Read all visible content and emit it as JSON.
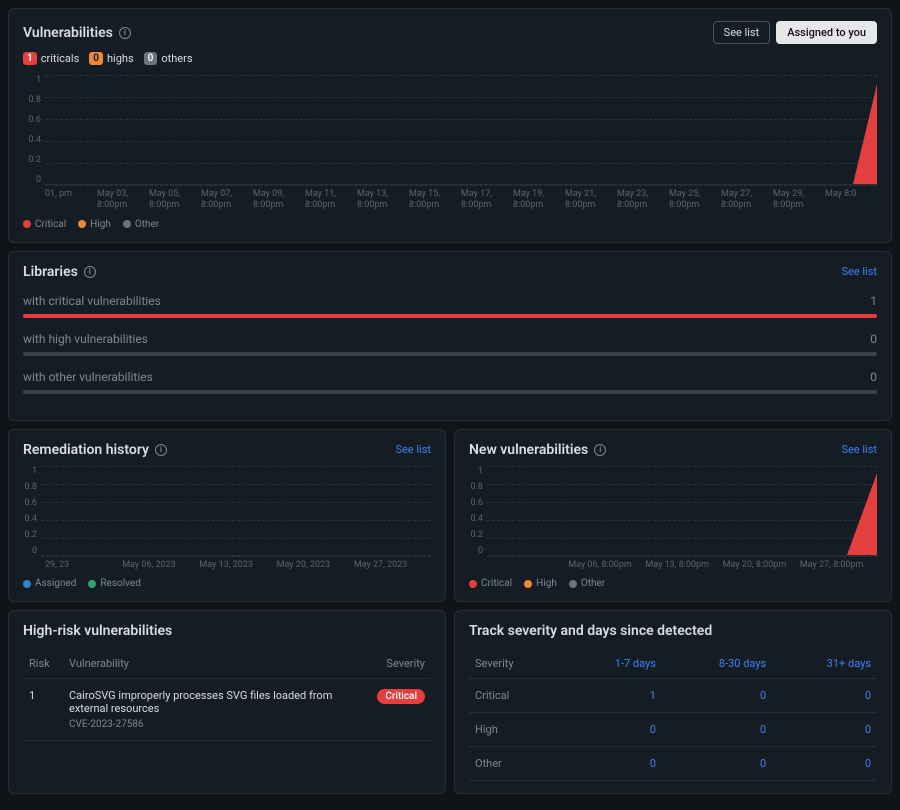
{
  "colors": {
    "red": "#e53e3e",
    "orange": "#ed8936",
    "gray": "#6b7280",
    "green": "#38a169",
    "blue": "#3182ce"
  },
  "vulnerabilities": {
    "title": "Vulnerabilities",
    "see_list": "See list",
    "assigned": "Assigned to you",
    "badges": {
      "criticals_n": "1",
      "criticals": "criticals",
      "highs_n": "0",
      "highs": "highs",
      "others_n": "0",
      "others": "others"
    },
    "legend": {
      "critical": "Critical",
      "high": "High",
      "other": "Other"
    }
  },
  "chart_data": [
    {
      "id": "vuln",
      "type": "area",
      "ylim": [
        0,
        1
      ],
      "yticks": [
        "1",
        "0.8",
        "0.6",
        "0.4",
        "0.2",
        "0"
      ],
      "xticks": [
        "01, pm",
        "May 03, 8:00pm",
        "May 05, 8:00pm",
        "May 07, 8:00pm",
        "May 09, 8:00pm",
        "May 11, 8:00pm",
        "May 13, 8:00pm",
        "May 15, 8:00pm",
        "May 17, 8:00pm",
        "May 19, 8:00pm",
        "May 21, 8:00pm",
        "May 23, 8:00pm",
        "May 25, 8:00pm",
        "May 27, 8:00pm",
        "May 29, 8:00pm",
        "May 8:0"
      ],
      "series": [
        {
          "name": "Critical",
          "color": "#e53e3e",
          "segments": [
            {
              "from": 14.5,
              "to": 15,
              "y0": 0,
              "y1": 1
            }
          ]
        },
        {
          "name": "High",
          "color": "#ed8936",
          "segments": []
        },
        {
          "name": "Other",
          "color": "#6b7280",
          "segments": []
        }
      ]
    },
    {
      "id": "remediation",
      "type": "area",
      "ylim": [
        0,
        1
      ],
      "yticks": [
        "1",
        "0.8",
        "0.6",
        "0.4",
        "0.2",
        "0"
      ],
      "xticks": [
        "29, 23",
        "May 06, 2023",
        "May 13, 2023",
        "May 20, 2023",
        "May 27, 2023"
      ],
      "series": [
        {
          "name": "Assigned",
          "color": "#3182ce",
          "segments": []
        },
        {
          "name": "Resolved",
          "color": "#38a169",
          "segments": []
        }
      ]
    },
    {
      "id": "newvuln",
      "type": "area",
      "ylim": [
        0,
        1
      ],
      "yticks": [
        "1",
        "0.8",
        "0.6",
        "0.4",
        "0.2",
        "0"
      ],
      "xticks": [
        "",
        "May 06, 8:00pm",
        "May 13, 8:00pm",
        "May 20, 8:00pm",
        "May 27, 8:00pm"
      ],
      "series": [
        {
          "name": "Critical",
          "color": "#e53e3e",
          "segments": [
            {
              "from": 3.7,
              "to": 4,
              "y0": 0,
              "y1": 1
            }
          ]
        },
        {
          "name": "High",
          "color": "#ed8936",
          "segments": []
        },
        {
          "name": "Other",
          "color": "#6b7280",
          "segments": []
        }
      ]
    }
  ],
  "libraries": {
    "title": "Libraries",
    "see_list": "See list",
    "rows": [
      {
        "label": "with critical vulnerabilities",
        "value": "1",
        "pct": 100,
        "color": "#e53e3e"
      },
      {
        "label": "with high vulnerabilities",
        "value": "0",
        "pct": 0,
        "color": "#ed8936"
      },
      {
        "label": "with other vulnerabilities",
        "value": "0",
        "pct": 0,
        "color": "#6b7280"
      }
    ]
  },
  "remediation": {
    "title": "Remediation history",
    "see_list": "See list",
    "legend": {
      "assigned": "Assigned",
      "resolved": "Resolved"
    }
  },
  "newvuln": {
    "title": "New vulnerabilities",
    "see_list": "See list",
    "legend": {
      "critical": "Critical",
      "high": "High",
      "other": "Other"
    }
  },
  "highrisk": {
    "title": "High-risk vulnerabilities",
    "cols": {
      "risk": "Risk",
      "vuln": "Vulnerability",
      "sev": "Severity"
    },
    "rows": [
      {
        "risk": "1",
        "name": "CairoSVG improperly processes SVG files loaded from external resources",
        "cve": "CVE-2023-27586",
        "sev": "Critical"
      }
    ]
  },
  "track": {
    "title": "Track severity and days since detected",
    "cols": {
      "sev": "Severity",
      "d1": "1-7 days",
      "d2": "8-30 days",
      "d3": "31+ days"
    },
    "rows": [
      {
        "sev": "Critical",
        "d1": "1",
        "d2": "0",
        "d3": "0"
      },
      {
        "sev": "High",
        "d1": "0",
        "d2": "0",
        "d3": "0"
      },
      {
        "sev": "Other",
        "d1": "0",
        "d2": "0",
        "d3": "0"
      }
    ]
  }
}
